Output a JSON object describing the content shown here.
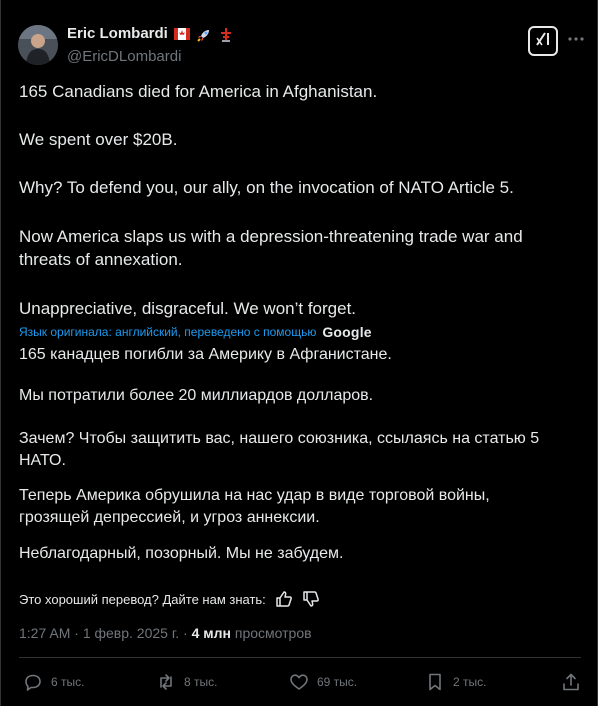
{
  "author": {
    "name": "Eric Lombardi",
    "handle": "@EricDLombardi"
  },
  "tweet": {
    "paragraphs": [
      "165 Canadians died for America in Afghanistan.",
      "We spent over $20B.",
      "Why? To defend you, our ally, on the invocation of NATO Article 5.",
      "Now America slaps us with a depression-threatening trade war and threats of annexation.",
      "Unappreciative, disgraceful. We won’t forget."
    ]
  },
  "translation": {
    "note": "Язык оригинала: английский, переведено с помощью",
    "provider": "Google",
    "paragraphs": [
      "165 канадцев погибли за Америку в Афганистане.",
      "Мы потратили более 20 миллиардов долларов.",
      "Зачем? Чтобы защитить вас, нашего союзника, ссылаясь на статью 5 НАТО.",
      "Теперь Америка обрушила на нас удар в виде торговой войны, грозящей депрессией, и угроз аннексии.",
      "Неблагодарный, позорный. Мы не забудем."
    ]
  },
  "feedback": {
    "prompt": "Это хороший перевод? Дайте нам знать:"
  },
  "meta": {
    "time": "1:27 AM",
    "date": "1 февр. 2025 г.",
    "views_count": "4 млн",
    "views_label": "просмотров"
  },
  "actions": {
    "replies": "6 тыс.",
    "reposts": "8 тыс.",
    "likes": "69 тыс.",
    "bookmarks": "2 тыс."
  },
  "colors": {
    "background": "#000000",
    "text": "#e7e9ea",
    "muted": "#71767b",
    "link": "#1d9bf0",
    "border": "#2f3336"
  },
  "icons": {
    "flag": "canada-flag-icon",
    "rocket": "rocket-icon",
    "tower": "tower-icon",
    "grok": "grok-icon",
    "more": "more-icon",
    "reply": "reply-icon",
    "repost": "repost-icon",
    "like": "like-icon",
    "bookmark": "bookmark-icon",
    "share": "share-icon"
  }
}
